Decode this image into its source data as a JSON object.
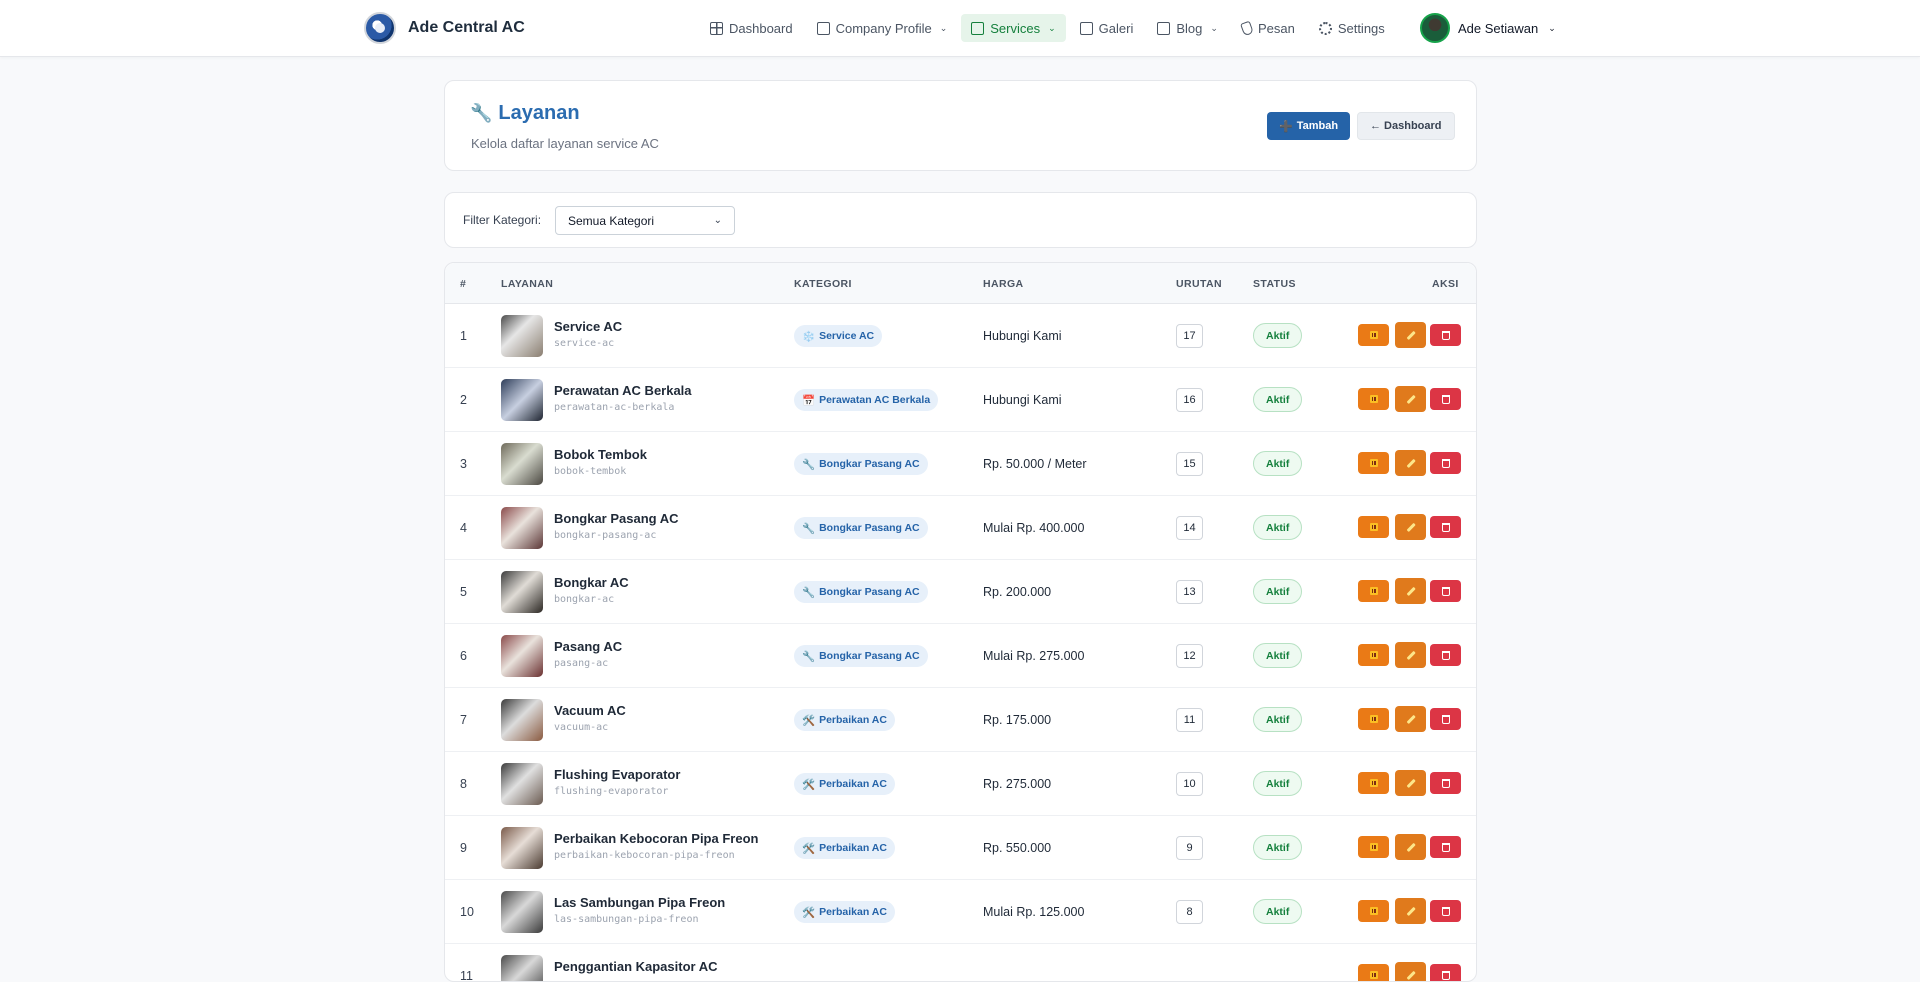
{
  "brand": {
    "name": "Ade Central AC"
  },
  "nav": {
    "items": [
      {
        "label": "Dashboard",
        "icon": "grid-icon"
      },
      {
        "label": "Company Profile",
        "icon": "document-icon",
        "dropdown": true
      },
      {
        "label": "Services",
        "icon": "briefcase-icon",
        "dropdown": true,
        "active": true
      },
      {
        "label": "Galeri",
        "icon": "image-icon"
      },
      {
        "label": "Blog",
        "icon": "document-icon",
        "dropdown": true
      },
      {
        "label": "Pesan",
        "icon": "phone-icon"
      },
      {
        "label": "Settings",
        "icon": "gear-icon"
      }
    ],
    "user": "Ade Setiawan"
  },
  "header": {
    "icon": "🔧",
    "title": "Layanan",
    "subtitle": "Kelola daftar layanan service AC",
    "add_label": "Tambah",
    "add_icon": "➕",
    "back_label": "← Dashboard"
  },
  "filter": {
    "label": "Filter Kategori:",
    "selected": "Semua Kategori"
  },
  "table": {
    "columns": {
      "num": "#",
      "service": "LAYANAN",
      "category": "KATEGORI",
      "price": "HARGA",
      "order": "URUTAN",
      "status": "STATUS",
      "actions": "AKSI"
    },
    "rows": [
      {
        "num": "1",
        "name": "Service AC",
        "slug": "service-ac",
        "cat_icon": "❄️",
        "category": "Service AC",
        "price": "Hubungi Kami",
        "order": "17",
        "status": "Aktif"
      },
      {
        "num": "2",
        "name": "Perawatan AC Berkala",
        "slug": "perawatan-ac-berkala",
        "cat_icon": "📅",
        "category": "Perawatan AC Berkala",
        "price": "Hubungi Kami",
        "order": "16",
        "status": "Aktif"
      },
      {
        "num": "3",
        "name": "Bobok Tembok",
        "slug": "bobok-tembok",
        "cat_icon": "🔧",
        "category": "Bongkar Pasang AC",
        "price": "Rp. 50.000 / Meter",
        "order": "15",
        "status": "Aktif"
      },
      {
        "num": "4",
        "name": "Bongkar Pasang AC",
        "slug": "bongkar-pasang-ac",
        "cat_icon": "🔧",
        "category": "Bongkar Pasang AC",
        "price": "Mulai Rp. 400.000",
        "order": "14",
        "status": "Aktif"
      },
      {
        "num": "5",
        "name": "Bongkar AC",
        "slug": "bongkar-ac",
        "cat_icon": "🔧",
        "category": "Bongkar Pasang AC",
        "price": "Rp. 200.000",
        "order": "13",
        "status": "Aktif"
      },
      {
        "num": "6",
        "name": "Pasang AC",
        "slug": "pasang-ac",
        "cat_icon": "🔧",
        "category": "Bongkar Pasang AC",
        "price": "Mulai Rp. 275.000",
        "order": "12",
        "status": "Aktif"
      },
      {
        "num": "7",
        "name": "Vacuum AC",
        "slug": "vacuum-ac",
        "cat_icon": "🛠️",
        "category": "Perbaikan AC",
        "price": "Rp. 175.000",
        "order": "11",
        "status": "Aktif"
      },
      {
        "num": "8",
        "name": "Flushing Evaporator",
        "slug": "flushing-evaporator",
        "cat_icon": "🛠️",
        "category": "Perbaikan AC",
        "price": "Rp. 275.000",
        "order": "10",
        "status": "Aktif"
      },
      {
        "num": "9",
        "name": "Perbaikan Kebocoran Pipa Freon",
        "slug": "perbaikan-kebocoran-pipa-freon",
        "cat_icon": "🛠️",
        "category": "Perbaikan AC",
        "price": "Rp. 550.000",
        "order": "9",
        "status": "Aktif"
      },
      {
        "num": "10",
        "name": "Las Sambungan Pipa Freon",
        "slug": "las-sambungan-pipa-freon",
        "cat_icon": "🛠️",
        "category": "Perbaikan AC",
        "price": "Mulai Rp. 125.000",
        "order": "8",
        "status": "Aktif"
      },
      {
        "num": "11",
        "name": "Penggantian Kapasitor AC",
        "slug": "",
        "cat_icon": "",
        "category": "",
        "price": "",
        "order": "",
        "status": ""
      }
    ]
  }
}
